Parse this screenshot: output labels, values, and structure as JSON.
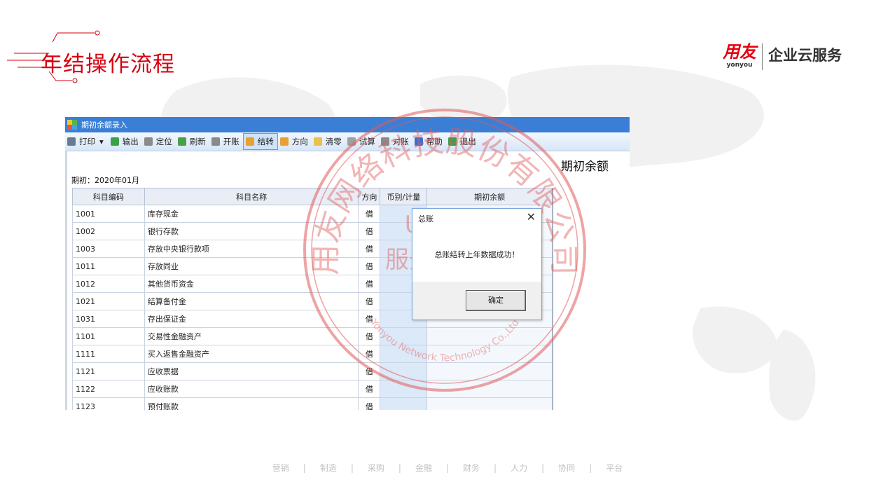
{
  "slide": {
    "title": "年结操作流程",
    "logo_cn": "用友",
    "logo_en": "yonyou",
    "logo_slogan": "企业云服务",
    "footer": [
      "营销",
      "制造",
      "采购",
      "金融",
      "财务",
      "人力",
      "协同",
      "平台"
    ],
    "footer_sep": "|"
  },
  "window": {
    "title": "期初余额录入",
    "report_title": "期初余额",
    "period": "期初：2020年01月"
  },
  "toolbar": [
    {
      "label": "打印",
      "icon": "printer-icon",
      "color": "#6a7b8f",
      "dropdown": true
    },
    {
      "label": "输出",
      "icon": "export-icon",
      "color": "#3aa04a"
    },
    {
      "label": "定位",
      "icon": "locate-icon",
      "color": "#8a8a8a"
    },
    {
      "label": "刷新",
      "icon": "refresh-icon",
      "color": "#4aa04a"
    },
    {
      "label": "开账",
      "icon": "open-book-icon",
      "color": "#8a8a8a"
    },
    {
      "label": "结转",
      "icon": "carry-forward-icon",
      "color": "#e8a032",
      "active": true
    },
    {
      "label": "方向",
      "icon": "direction-icon",
      "color": "#e8a032"
    },
    {
      "label": "清零",
      "icon": "eraser-icon",
      "color": "#e8c24a"
    },
    {
      "label": "试算",
      "icon": "calculator-icon",
      "color": "#a0a0a0"
    },
    {
      "label": "对账",
      "icon": "reconcile-icon",
      "color": "#8a8a8a"
    },
    {
      "label": "帮助",
      "icon": "help-icon",
      "color": "#3c6fd1"
    },
    {
      "label": "退出",
      "icon": "exit-icon",
      "color": "#3aa04a"
    }
  ],
  "table": {
    "columns": [
      "科目编码",
      "科目名称",
      "方向",
      "币别/计量",
      "期初余额"
    ],
    "rows": [
      [
        "1001",
        "库存现金",
        "借",
        "",
        ""
      ],
      [
        "1002",
        "银行存款",
        "借",
        "",
        ""
      ],
      [
        "1003",
        "存放中央银行款项",
        "借",
        "",
        ""
      ],
      [
        "1011",
        "存放同业",
        "借",
        "",
        ""
      ],
      [
        "1012",
        "其他货币资金",
        "借",
        "",
        ""
      ],
      [
        "1021",
        "结算备付金",
        "借",
        "",
        ""
      ],
      [
        "1031",
        "存出保证金",
        "借",
        "",
        ""
      ],
      [
        "1101",
        "交易性金融资产",
        "借",
        "",
        ""
      ],
      [
        "1111",
        "买入返售金融资产",
        "借",
        "",
        ""
      ],
      [
        "1121",
        "应收票据",
        "借",
        "",
        ""
      ],
      [
        "1122",
        "应收账款",
        "借",
        "",
        ""
      ],
      [
        "1123",
        "预付账款",
        "借",
        "",
        ""
      ]
    ]
  },
  "dialog": {
    "title": "总账",
    "message": "总账结转上年数据成功！",
    "ok_label": "确定",
    "close_glyph": "✕"
  },
  "stamp": {
    "text": "用友网络科技股份有限公司",
    "line1": "U8支持",
    "line2": "服务事业部",
    "en": "Yonyou Network Technology Co.,Ltd",
    "color": "#e05a5a"
  }
}
